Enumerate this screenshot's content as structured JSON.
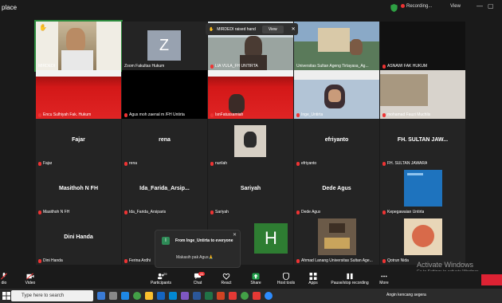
{
  "window": {
    "title": "place",
    "recording": "Recording...",
    "view": "View"
  },
  "raised_hand": {
    "text": "MIRDEDI raised hand",
    "view_label": "View",
    "close": "✕"
  },
  "tiles": [
    {
      "name": "MIRDEDI",
      "kind": "video"
    },
    {
      "name": "Zoom Fakultas Hukum",
      "kind": "avatar",
      "letter": "Z"
    },
    {
      "name": "LIA VULA_FH UNTIRTA",
      "kind": "video"
    },
    {
      "name": "Universitas Sultan Ageng Tirtayasa_Ag...",
      "kind": "video"
    },
    {
      "name": "ASNAWI  FAK HUKUM",
      "kind": "dark"
    },
    {
      "name": "Encu Sulhiyah Fak. Hukum",
      "kind": "slide"
    },
    {
      "name": "Agus moh zaenal m /FH Untirta",
      "kind": "dark"
    },
    {
      "name": "IsnFatussamiah",
      "kind": "slide"
    },
    {
      "name": "Inge_Untirta",
      "kind": "video"
    },
    {
      "name": "mohamad Fauzi Muchlis",
      "kind": "video"
    },
    {
      "name": "Fajar",
      "big": "Fajar"
    },
    {
      "name": "rena",
      "big": "rena"
    },
    {
      "name": "nurilah",
      "kind": "photo"
    },
    {
      "name": "efriyanto",
      "big": "efriyanto"
    },
    {
      "name": "FH. SULTAN JAWARA",
      "big": "FH. SULTAN JAW..."
    },
    {
      "name": "Masithoh N FH",
      "big": "Masithoh N FH"
    },
    {
      "name": "Ida_Farida_Arsiparis",
      "big": "Ida_Farida_Arsip..."
    },
    {
      "name": "Sariyah",
      "big": "Sariyah"
    },
    {
      "name": "Dede Agus",
      "big": "Dede Agus"
    },
    {
      "name": "Kepegawaian Untirta",
      "kind": "screen"
    },
    {
      "name": "Dini Handa",
      "big": "Dini Handa"
    },
    {
      "name": "Ferina Ardhi",
      "kind": "dark"
    },
    {
      "name": "H",
      "kind": "avatar2",
      "letter": "H"
    },
    {
      "name": "Ahmad Lanang Universitas Sultan Age...",
      "kind": "photo2"
    },
    {
      "name": "Qotrun Nida",
      "kind": "photo3"
    }
  ],
  "chat": {
    "from": "From Inge_Untirta to everyone",
    "message": "Makasih pak Agus🙏",
    "avatar": "I"
  },
  "toolbar": [
    {
      "label": "dio",
      "icon": "mic-icon"
    },
    {
      "label": "Video",
      "icon": "camera-icon"
    },
    {
      "label": "Participants",
      "icon": "people-icon",
      "count": "29"
    },
    {
      "label": "Chat",
      "icon": "chat-icon",
      "count": "41"
    },
    {
      "label": "React",
      "icon": "heart-icon"
    },
    {
      "label": "Share",
      "icon": "share-icon"
    },
    {
      "label": "Host tools",
      "icon": "shield-icon"
    },
    {
      "label": "Apps",
      "icon": "apps-icon"
    },
    {
      "label": "Pause/stop recording",
      "icon": "pause-icon"
    },
    {
      "label": "More",
      "icon": "more-icon"
    }
  ],
  "activation": {
    "title": "Activate Windows",
    "sub": "Go to Settings to activate Windows."
  },
  "taskbar": {
    "search": "Type here to search",
    "weather": "Angin kencang segera"
  },
  "colors": {
    "active_border": "#2d8c3e",
    "rec_red": "#e33",
    "taskbar": "#2b2b2b"
  }
}
